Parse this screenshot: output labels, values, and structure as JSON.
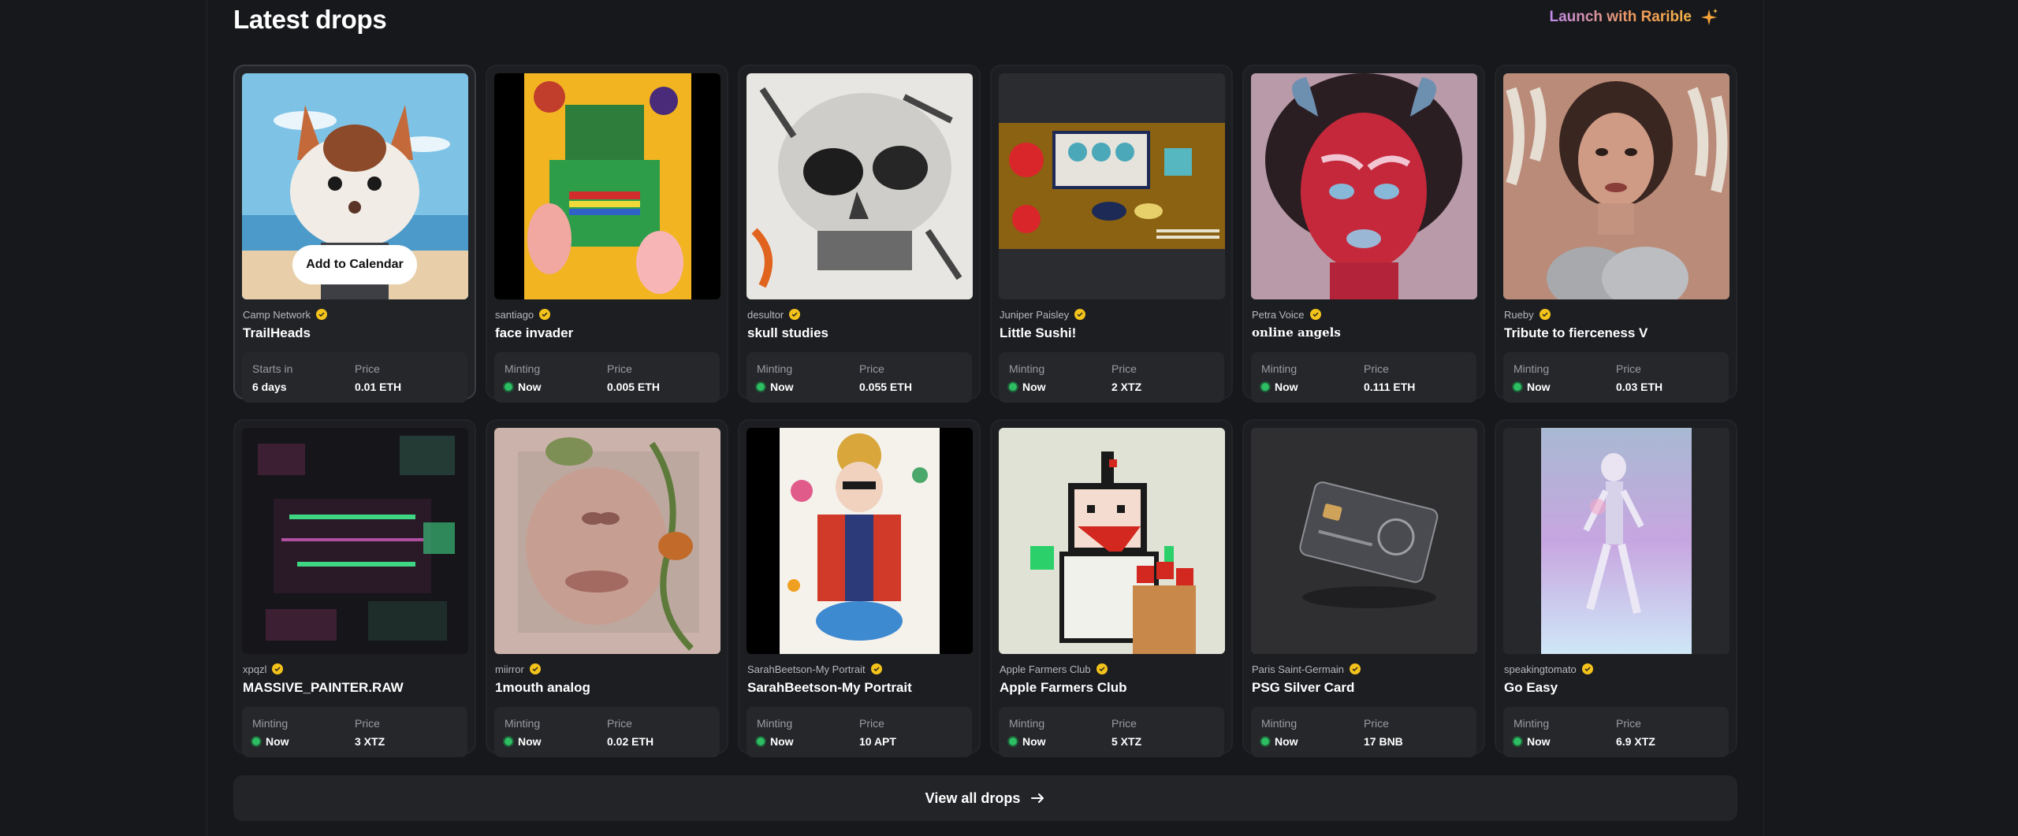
{
  "header": {
    "title": "Latest drops",
    "launch_label": "Launch with Rarible",
    "launch_icon": "sparkle-icon"
  },
  "drops": [
    {
      "creator": "Camp Network",
      "name": "TrailHeads",
      "status_label": "Starts in",
      "status_value": "6 days",
      "price_label": "Price",
      "price": "0.01 ETH",
      "calendar_label": "Add to Calendar"
    },
    {
      "creator": "santiago",
      "name": "face invader",
      "status_label": "Minting",
      "status_value": "Now",
      "price_label": "Price",
      "price": "0.005 ETH"
    },
    {
      "creator": "desultor",
      "name": "skull studies",
      "status_label": "Minting",
      "status_value": "Now",
      "price_label": "Price",
      "price": "0.055 ETH"
    },
    {
      "creator": "Juniper Paisley",
      "name": "Little Sushi!",
      "status_label": "Minting",
      "status_value": "Now",
      "price_label": "Price",
      "price": "2 XTZ"
    },
    {
      "creator": "Petra Voice",
      "name": "online angels",
      "status_label": "Minting",
      "status_value": "Now",
      "price_label": "Price",
      "price": "0.111 ETH"
    },
    {
      "creator": "Rueby",
      "name": "Tribute to fierceness V",
      "status_label": "Minting",
      "status_value": "Now",
      "price_label": "Price",
      "price": "0.03 ETH"
    },
    {
      "creator": "xpqzl",
      "name": "MASSIVE_PAINTER.RAW",
      "status_label": "Minting",
      "status_value": "Now",
      "price_label": "Price",
      "price": "3 XTZ"
    },
    {
      "creator": "miirror",
      "name": "1mouth analog",
      "status_label": "Minting",
      "status_value": "Now",
      "price_label": "Price",
      "price": "0.02 ETH"
    },
    {
      "creator": "SarahBeetson-My Portrait",
      "name": "SarahBeetson-My Portrait",
      "status_label": "Minting",
      "status_value": "Now",
      "price_label": "Price",
      "price": "10 APT"
    },
    {
      "creator": "Apple Farmers Club",
      "name": "Apple Farmers Club",
      "status_label": "Minting",
      "status_value": "Now",
      "price_label": "Price",
      "price": "5 XTZ"
    },
    {
      "creator": "Paris Saint-Germain",
      "name": "PSG Silver Card",
      "status_label": "Minting",
      "status_value": "Now",
      "price_label": "Price",
      "price": "17 BNB"
    },
    {
      "creator": "speakingtomato",
      "name": "Go Easy",
      "status_label": "Minting",
      "status_value": "Now",
      "price_label": "Price",
      "price": "6.9 XTZ"
    }
  ],
  "footer": {
    "view_all_label": "View all drops",
    "arrow_icon": "arrow-right-icon"
  },
  "colors": {
    "background": "#17181b",
    "card": "#1d1e22",
    "verified": "#f3c21b",
    "minting_dot": "#2dbd62"
  }
}
